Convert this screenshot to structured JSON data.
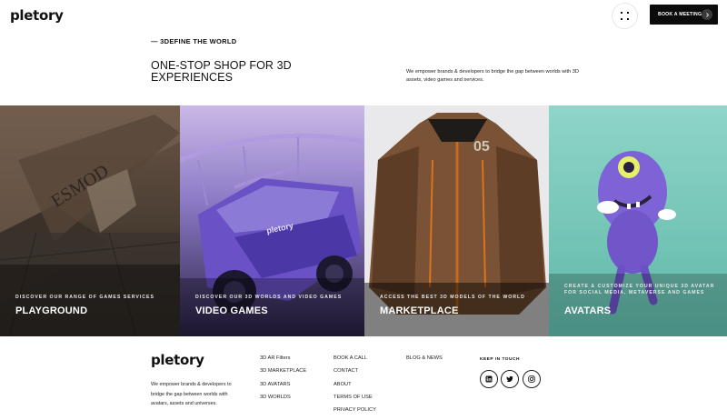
{
  "header": {
    "logo": "pletory",
    "menu_icon": "dots-grid-icon",
    "book_button": "BOOK A MEETING",
    "book_arrow_icon": "chevron-right-icon"
  },
  "hero": {
    "eyebrow": "— 3DEFINE THE WORLD",
    "headline": "ONE-STOP SHOP FOR 3D EXPERIENCES",
    "intro": "We empower brands & developers to bridge the gap between worlds with 3D assets, video games and services."
  },
  "panels": [
    {
      "caption": "DISCOVER OUR RANGE OF GAMES SERVICES",
      "title": "PLAYGROUND"
    },
    {
      "caption": "DISCOVER OUR 3D WORLDS AND VIDEO GAMES",
      "title": "VIDEO GAMES"
    },
    {
      "caption": "ACCESS THE BEST 3D MODELS OF THE WORLD",
      "title": "MARKETPLACE"
    },
    {
      "caption": "CREATE & CUSTOMIZE YOUR UNIQUE 3D AVATAR FOR SOCIAL MEDIA, METAVERSE AND GAMES",
      "title": "AVATARS"
    }
  ],
  "footer": {
    "logo": "pletory",
    "text": "We empower brands & developers to bridge the gap between worlds with avatars, assets and universes.",
    "col1": [
      "3D AR Filters",
      "3D MARKETPLACE",
      "3D AVATARS",
      "3D WORLDS"
    ],
    "col2": [
      "BOOK A CALL",
      "CONTACT",
      "ABOUT",
      "TERMS OF USE",
      "PRIVACY POLICY"
    ],
    "col3": [
      "BLOG & NEWS"
    ],
    "keep_in_touch": "KEEP IN TOUCH",
    "social": [
      "linkedin-icon",
      "twitter-icon",
      "instagram-icon"
    ]
  }
}
